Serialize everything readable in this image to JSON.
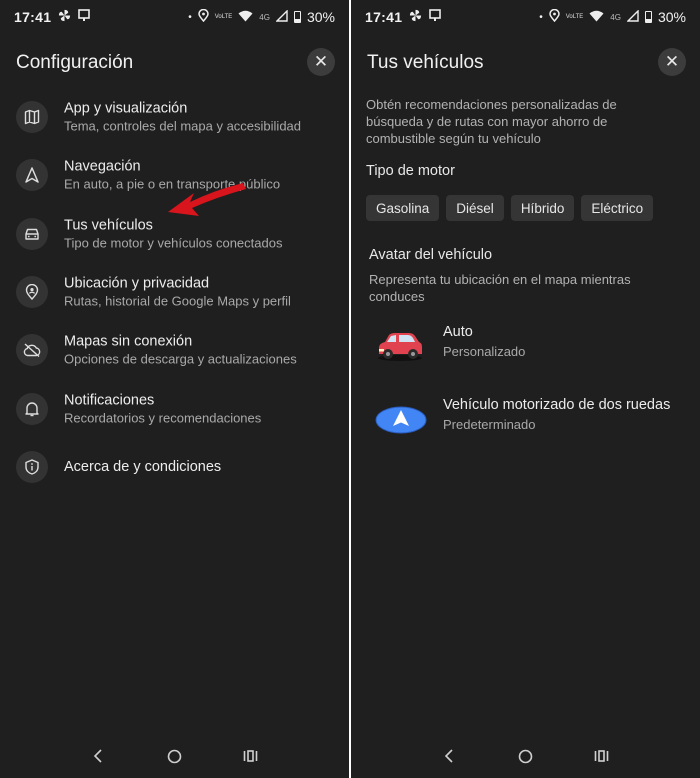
{
  "status": {
    "time": "17:41",
    "volte": "VoLTE",
    "network": "4G",
    "battery": "30%"
  },
  "left": {
    "title": "Configuración",
    "items": [
      {
        "label": "App y visualización",
        "sub": "Tema, controles del mapa y accesibilidad",
        "icon": "map-icon"
      },
      {
        "label": "Navegación",
        "sub": "En auto, a pie o en transporte público",
        "icon": "navigation-arrow-icon"
      },
      {
        "label": "Tus vehículos",
        "sub": "Tipo de motor y vehículos conectados",
        "icon": "car-icon"
      },
      {
        "label": "Ubicación y privacidad",
        "sub": "Rutas, historial de Google Maps y perfil",
        "icon": "location-pin-icon"
      },
      {
        "label": "Mapas sin conexión",
        "sub": "Opciones de descarga y actualizaciones",
        "icon": "cloud-off-icon"
      },
      {
        "label": "Notificaciones",
        "sub": "Recordatorios y recomendaciones",
        "icon": "bell-icon"
      },
      {
        "label": "Acerca de y condiciones",
        "sub": "",
        "icon": "info-shield-icon"
      }
    ]
  },
  "right": {
    "title": "Tus vehículos",
    "description": "Obtén recomendaciones personalizadas de búsqueda y de rutas con mayor ahorro de combustible según tu vehículo",
    "engine_label": "Tipo de motor",
    "engine_chips": [
      "Gasolina",
      "Diésel",
      "Híbrido",
      "Eléctrico"
    ],
    "avatar_title": "Avatar del vehículo",
    "avatar_desc": "Representa tu ubicación en el mapa mientras conduces",
    "vehicles": [
      {
        "name": "Auto",
        "sub": "Personalizado",
        "icon": "red-car-icon"
      },
      {
        "name": "Vehículo motorizado de dos ruedas",
        "sub": "Predeterminado",
        "icon": "blue-nav-arrow-icon"
      }
    ]
  },
  "colors": {
    "background": "#1f1f1f",
    "chip": "#353535",
    "arrow_annotation": "#d8141c",
    "nav_arrow_blue": "#4285f4"
  }
}
